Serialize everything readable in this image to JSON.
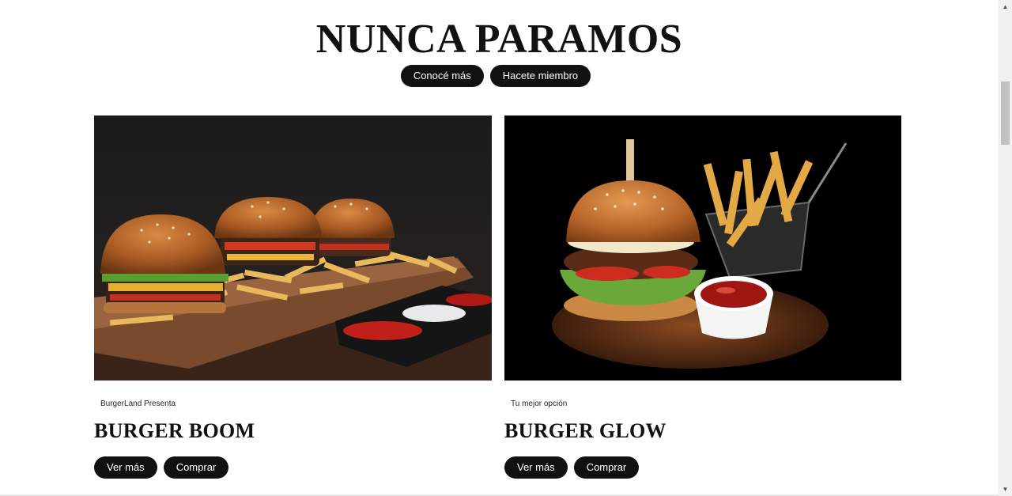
{
  "hero": {
    "title": "NUNCA PARAMOS",
    "button_learn": "Conocé más",
    "button_join": "Hacete miembro"
  },
  "cards": [
    {
      "eyebrow": "BurgerLand Presenta",
      "title": "BURGER BOOM",
      "button_more": "Ver más",
      "button_buy": "Comprar",
      "image_name": "burger-trio-photo"
    },
    {
      "eyebrow": "Tu mejor opción",
      "title": "BURGER GLOW",
      "button_more": "Ver más",
      "button_buy": "Comprar",
      "image_name": "burger-fries-photo"
    }
  ],
  "colors": {
    "button_bg": "#111111",
    "button_text": "#ffffff",
    "title": "#111111"
  },
  "icons": {
    "scroll_up": "triangle-up-icon",
    "scroll_down": "triangle-down-icon"
  }
}
